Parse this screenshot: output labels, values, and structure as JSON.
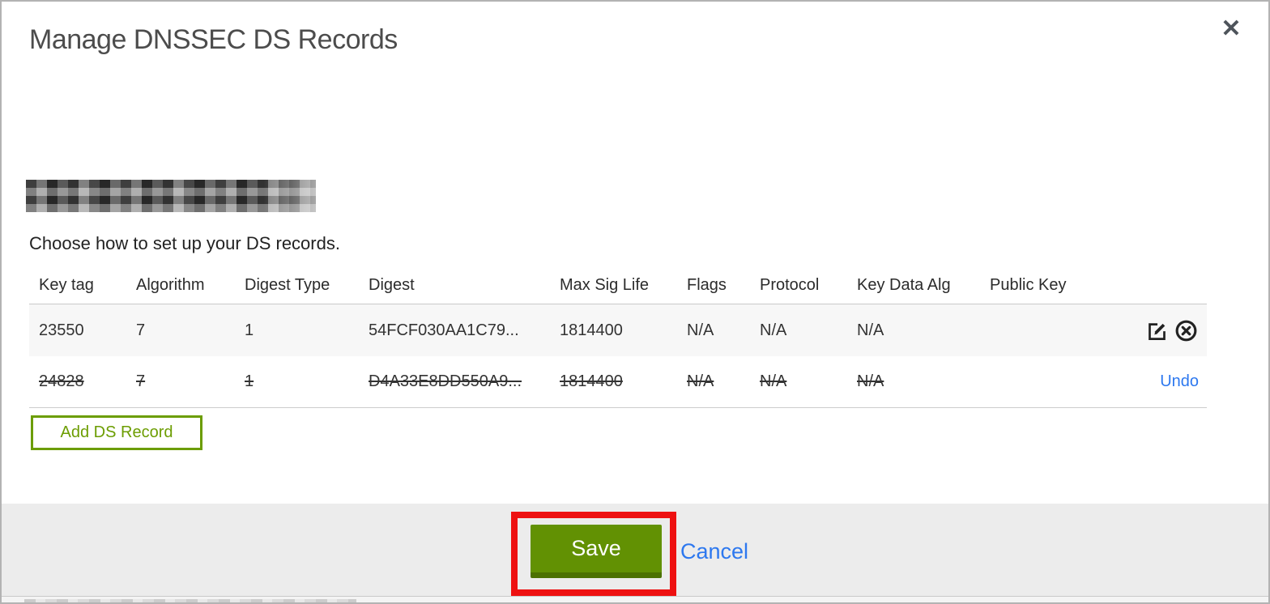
{
  "dialog": {
    "title": "Manage DNSSEC DS Records",
    "instruction": "Choose how to set up your DS records.",
    "domain_redacted": true,
    "table": {
      "columns": [
        "Key tag",
        "Algorithm",
        "Digest Type",
        "Digest",
        "Max Sig Life",
        "Flags",
        "Protocol",
        "Key Data Alg",
        "Public Key"
      ],
      "rows": [
        {
          "key_tag": "23550",
          "algorithm": "7",
          "digest_type": "1",
          "digest": "54FCF030AA1C79...",
          "max_sig_life": "1814400",
          "flags": "N/A",
          "protocol": "N/A",
          "key_data_alg": "N/A",
          "public_key": "",
          "deleted": false
        },
        {
          "key_tag": "24828",
          "algorithm": "7",
          "digest_type": "1",
          "digest": "D4A33E8DD550A9...",
          "max_sig_life": "1814400",
          "flags": "N/A",
          "protocol": "N/A",
          "key_data_alg": "N/A",
          "public_key": "",
          "deleted": true,
          "undo_label": "Undo"
        }
      ]
    },
    "add_button_label": "Add DS Record",
    "footer": {
      "save_label": "Save",
      "cancel_label": "Cancel"
    }
  },
  "icons": {
    "close": "✕",
    "edit": "pencil-square",
    "delete": "circle-x"
  },
  "colors": {
    "accent_green": "#629103",
    "accent_green_dark": "#4c7101",
    "outline_green": "#6c9d02",
    "link_blue": "#2d78ef",
    "footer_bg": "#ececec",
    "row_alt_bg": "#f7f7f7",
    "annotation_red": "#ee1111",
    "title_gray": "#4c4c4c"
  }
}
